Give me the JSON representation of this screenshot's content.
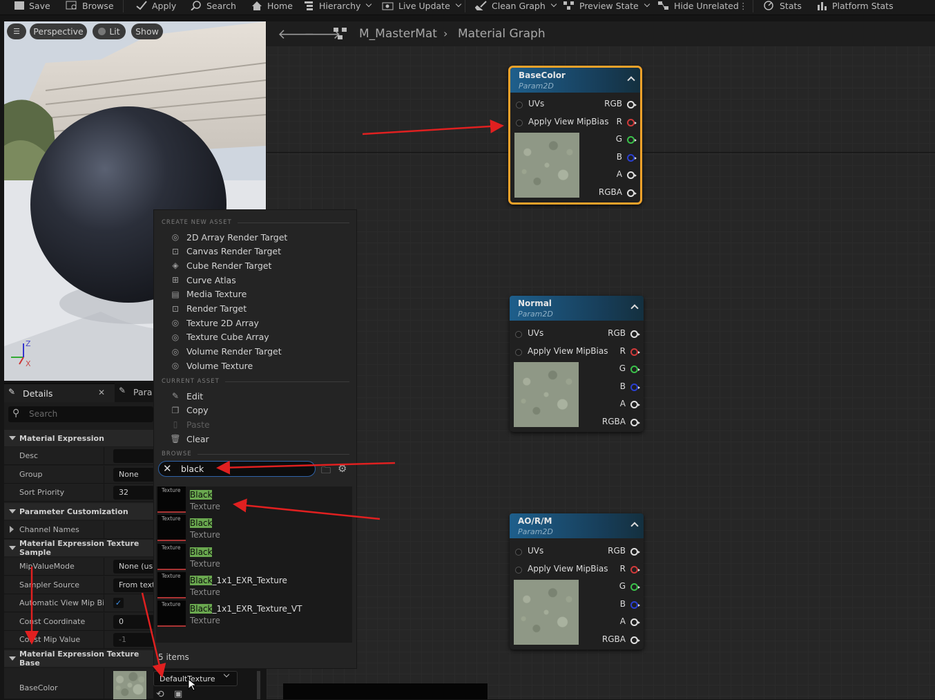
{
  "toolbar": {
    "items": [
      "Save",
      "Browse",
      "Apply",
      "Search",
      "Home",
      "Hierarchy",
      "Live Update",
      "Clean Graph",
      "Preview State",
      "Hide Unrelated",
      "Stats",
      "Platform Stats"
    ]
  },
  "viewport": {
    "buttons": [
      "Perspective",
      "Lit",
      "Show"
    ],
    "axis": {
      "z": "Z",
      "x": "X"
    }
  },
  "graph": {
    "breadcrumb": [
      "M_MasterMat",
      "Material Graph"
    ],
    "nodes": [
      {
        "title": "BaseColor",
        "subtitle": "Param2D",
        "selected": true
      },
      {
        "title": "Normal",
        "subtitle": "Param2D",
        "selected": false
      },
      {
        "title": "AO/R/M",
        "subtitle": "Param2D",
        "selected": false
      }
    ],
    "inputs": [
      "UVs",
      "Apply View MipBias"
    ],
    "outputs": [
      "RGB",
      "R",
      "G",
      "B",
      "A",
      "RGBA"
    ],
    "output_colors": [
      "#e0e0e0",
      "#d03a3a",
      "#3ac04a",
      "#2a3fd0",
      "#e0e0e0",
      "#e0e0e0"
    ]
  },
  "details": {
    "tabs": [
      "Details",
      "Para"
    ],
    "search_placeholder": "Search",
    "sections": {
      "material_expression": "Material Expression",
      "param_customization": "Parameter Customization",
      "texture_sample": "Material Expression Texture Sample",
      "texture_base": "Material Expression Texture Base"
    },
    "rows": {
      "desc": {
        "label": "Desc",
        "value": ""
      },
      "group": {
        "label": "Group",
        "value": "None"
      },
      "sort_priority": {
        "label": "Sort Priority",
        "value": "32"
      },
      "channel_names": {
        "label": "Channel Names"
      },
      "mip_value_mode": {
        "label": "MipValueMode",
        "value": "None (use"
      },
      "sampler_source": {
        "label": "Sampler Source",
        "value": "From textu"
      },
      "auto_view_mip": {
        "label": "Automatic View Mip Bi...",
        "checked": true
      },
      "const_coordinate": {
        "label": "Const Coordinate",
        "value": "0"
      },
      "const_mip_value": {
        "label": "Const Mip Value",
        "value": "-1"
      },
      "basecolor": {
        "label": "BaseColor"
      }
    },
    "texture_dropdown": "DefaultTexture"
  },
  "menu": {
    "headers": {
      "create": "CREATE NEW ASSET",
      "current": "CURRENT ASSET",
      "browse": "BROWSE"
    },
    "create_items": [
      "2D Array Render Target",
      "Canvas Render Target",
      "Cube Render Target",
      "Curve Atlas",
      "Media Texture",
      "Render Target",
      "Texture 2D Array",
      "Texture Cube Array",
      "Volume Render Target",
      "Volume Texture"
    ],
    "current_items": [
      {
        "label": "Edit",
        "icon": "pencil-icon",
        "enabled": true
      },
      {
        "label": "Copy",
        "icon": "copy-icon",
        "enabled": true
      },
      {
        "label": "Paste",
        "icon": "paste-icon",
        "enabled": false
      },
      {
        "label": "Clear",
        "icon": "trash-icon",
        "enabled": true
      }
    ],
    "search_value": "black",
    "results": [
      {
        "match": "Black",
        "rest": "",
        "type": "Texture",
        "thumb_label": "Texture"
      },
      {
        "match": "Black",
        "rest": "",
        "type": "Texture",
        "thumb_label": "Texture"
      },
      {
        "match": "Black",
        "rest": "",
        "type": "Texture",
        "thumb_label": "Texture"
      },
      {
        "match": "Black",
        "rest": "_1x1_EXR_Texture",
        "type": "Texture",
        "thumb_label": "Texture"
      },
      {
        "match": "Black",
        "rest": "_1x1_EXR_Texture_VT",
        "type": "Texture",
        "thumb_label": "Texture"
      }
    ],
    "item_count": "5 items"
  },
  "colors": {
    "accent": "#f0a22a",
    "node_header": "#1e5f8c",
    "search_border": "#2f63a8",
    "highlight": "#6aa84f",
    "annotation": "#e02020"
  }
}
